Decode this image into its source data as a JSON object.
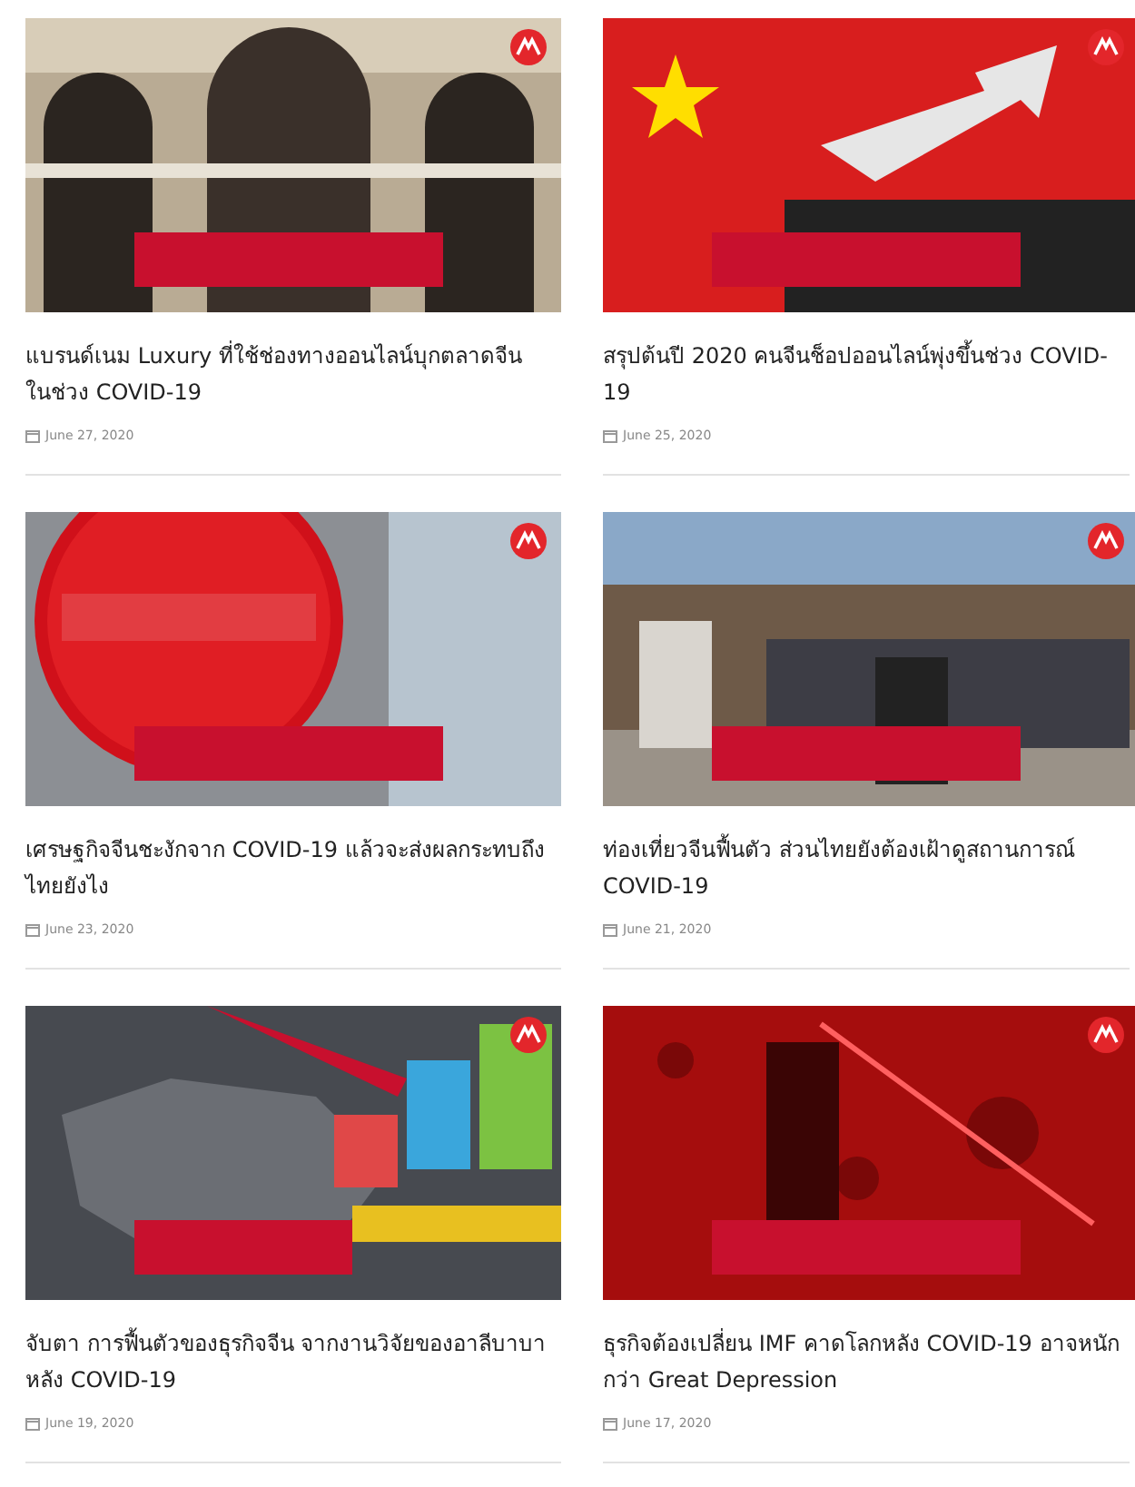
{
  "posts": [
    {
      "title": "แบรนด์เนม Luxury ที่ใช้ช่องทางออนไลน์บุกตลาดจีน ในช่วง COVID-19",
      "date": "June 27, 2020"
    },
    {
      "title": "สรุปต้นปี 2020 คนจีนช็อปออนไลน์พุ่งขึ้นช่วง COVID-19",
      "date": "June 25, 2020"
    },
    {
      "title": "เศรษฐกิจจีนชะงักจาก COVID-19 แล้วจะส่งผลกระทบถึงไทยยังไง",
      "date": "June 23, 2020"
    },
    {
      "title": "ท่องเที่ยวจีนฟื้นตัว ส่วนไทยยังต้องเฝ้าดูสถานการณ์ COVID-19",
      "date": "June 21, 2020"
    },
    {
      "title": "จับตา การฟื้นตัวของธุรกิจจีน จากงานวิจัยของอาลีบาบา หลัง COVID-19",
      "date": "June 19, 2020"
    },
    {
      "title": "ธุรกิจต้องเปลี่ยน IMF คาดโลกหลัง COVID-19 อาจหนักกว่า Great Depression",
      "date": "June 17, 2020"
    }
  ]
}
